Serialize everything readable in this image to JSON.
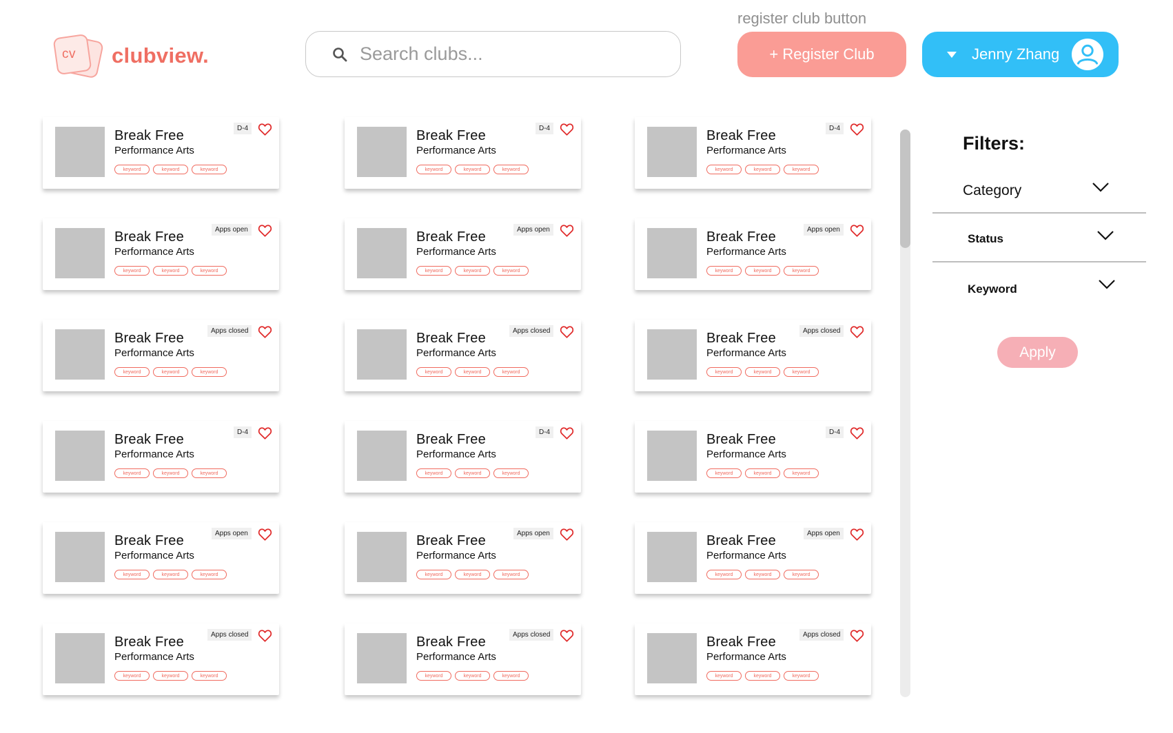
{
  "annotation": "register club button",
  "logo": {
    "letters": "cv",
    "name": "clubview."
  },
  "search": {
    "placeholder": "Search clubs..."
  },
  "register_button": {
    "label": "+ Register Club"
  },
  "user": {
    "name": "Jenny Zhang"
  },
  "colors": {
    "brand": "#ef6f63",
    "register": "#fa9c95",
    "user": "#32bff7",
    "apply": "#f6afb6",
    "tag": "#f06a5e",
    "heart": "#e02a2a"
  },
  "cards": [
    {
      "title": "Break Free",
      "subtitle": "Performance Arts",
      "status": "D-4",
      "tags": [
        "keyword",
        "keyword",
        "keyword"
      ]
    },
    {
      "title": "Break Free",
      "subtitle": "Performance Arts",
      "status": "D-4",
      "tags": [
        "keyword",
        "keyword",
        "keyword"
      ]
    },
    {
      "title": "Break Free",
      "subtitle": "Performance Arts",
      "status": "D-4",
      "tags": [
        "keyword",
        "keyword",
        "keyword"
      ]
    },
    {
      "title": "Break Free",
      "subtitle": "Performance Arts",
      "status": "Apps open",
      "tags": [
        "keyword",
        "keyword",
        "keyword"
      ]
    },
    {
      "title": "Break Free",
      "subtitle": "Performance Arts",
      "status": "Apps open",
      "tags": [
        "keyword",
        "keyword",
        "keyword"
      ]
    },
    {
      "title": "Break Free",
      "subtitle": "Performance Arts",
      "status": "Apps open",
      "tags": [
        "keyword",
        "keyword",
        "keyword"
      ]
    },
    {
      "title": "Break Free",
      "subtitle": "Performance Arts",
      "status": "Apps closed",
      "tags": [
        "keyword",
        "keyword",
        "keyword"
      ]
    },
    {
      "title": "Break Free",
      "subtitle": "Performance Arts",
      "status": "Apps closed",
      "tags": [
        "keyword",
        "keyword",
        "keyword"
      ]
    },
    {
      "title": "Break Free",
      "subtitle": "Performance Arts",
      "status": "Apps closed",
      "tags": [
        "keyword",
        "keyword",
        "keyword"
      ]
    },
    {
      "title": "Break Free",
      "subtitle": "Performance Arts",
      "status": "D-4",
      "tags": [
        "keyword",
        "keyword",
        "keyword"
      ]
    },
    {
      "title": "Break Free",
      "subtitle": "Performance Arts",
      "status": "D-4",
      "tags": [
        "keyword",
        "keyword",
        "keyword"
      ]
    },
    {
      "title": "Break Free",
      "subtitle": "Performance Arts",
      "status": "D-4",
      "tags": [
        "keyword",
        "keyword",
        "keyword"
      ]
    },
    {
      "title": "Break Free",
      "subtitle": "Performance Arts",
      "status": "Apps open",
      "tags": [
        "keyword",
        "keyword",
        "keyword"
      ]
    },
    {
      "title": "Break Free",
      "subtitle": "Performance Arts",
      "status": "Apps open",
      "tags": [
        "keyword",
        "keyword",
        "keyword"
      ]
    },
    {
      "title": "Break Free",
      "subtitle": "Performance Arts",
      "status": "Apps open",
      "tags": [
        "keyword",
        "keyword",
        "keyword"
      ]
    },
    {
      "title": "Break Free",
      "subtitle": "Performance Arts",
      "status": "Apps closed",
      "tags": [
        "keyword",
        "keyword",
        "keyword"
      ]
    },
    {
      "title": "Break Free",
      "subtitle": "Performance Arts",
      "status": "Apps closed",
      "tags": [
        "keyword",
        "keyword",
        "keyword"
      ]
    },
    {
      "title": "Break Free",
      "subtitle": "Performance Arts",
      "status": "Apps closed",
      "tags": [
        "keyword",
        "keyword",
        "keyword"
      ]
    }
  ],
  "filters": {
    "title": "Filters:",
    "items": [
      {
        "label": "Category"
      },
      {
        "label": "Status"
      },
      {
        "label": "Keyword"
      }
    ],
    "apply_label": "Apply"
  }
}
